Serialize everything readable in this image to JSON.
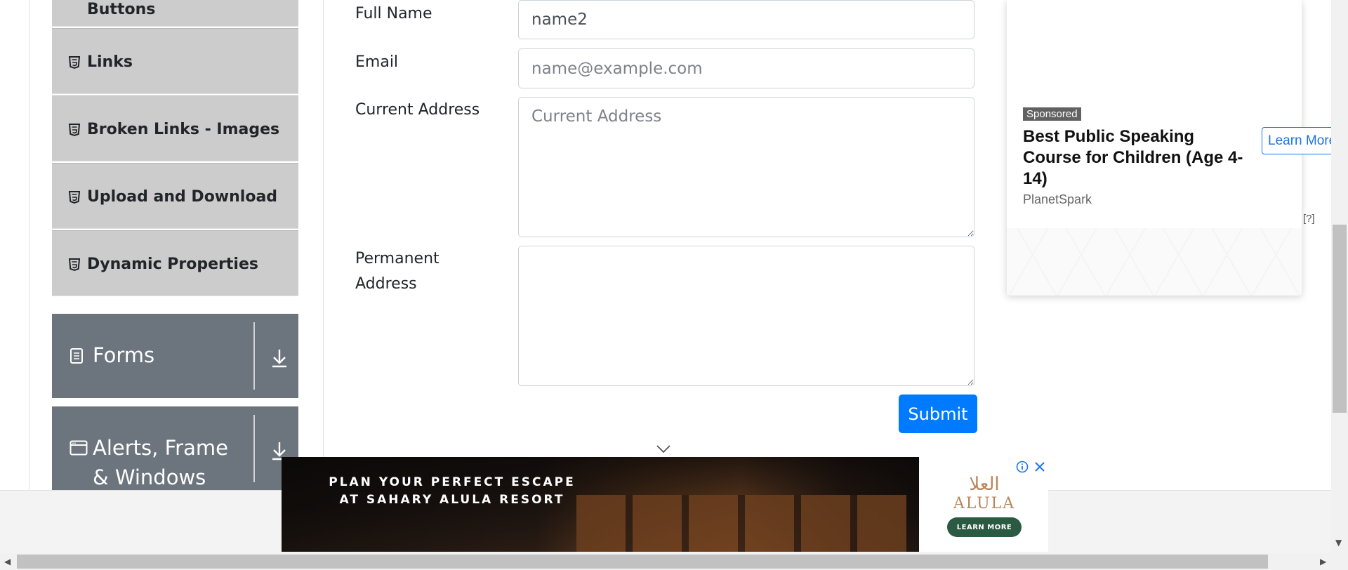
{
  "sidebar": {
    "top_partial_label": "Buttons",
    "items": [
      {
        "label": "Links",
        "icon": "html5-icon"
      },
      {
        "label": "Broken Links - Images",
        "icon": "html5-icon"
      },
      {
        "label": "Upload and Download",
        "icon": "html5-icon"
      },
      {
        "label": "Dynamic Properties",
        "icon": "html5-icon"
      }
    ],
    "groups": [
      {
        "label": "Forms",
        "icon": "document-icon",
        "arrow": "download-arrow-icon"
      },
      {
        "label": "Alerts, Frame & Windows",
        "icon": "window-icon",
        "arrow": "download-arrow-icon"
      }
    ]
  },
  "form": {
    "full_name": {
      "label": "Full Name",
      "value": "name2"
    },
    "email": {
      "label": "Email",
      "placeholder": "name@example.com",
      "value": ""
    },
    "current_address": {
      "label": "Current Address",
      "placeholder": "Current Address",
      "value": ""
    },
    "permanent_address": {
      "label": "Permanent Address",
      "value": ""
    },
    "submit_label": "Submit"
  },
  "ad_right": {
    "badge": "Sponsored",
    "title": "Best Public Speaking Course for Children (Age 4-14)",
    "brand": "PlanetSpark",
    "cta": "Learn More",
    "info": "[?]"
  },
  "ad_bottom": {
    "headline": "PLAN YOUR PERFECT ESCAPE AT SAHARY ALULA RESORT",
    "brand_ar": "العلا",
    "brand_en": "ALULA",
    "cta": "LEARN MORE"
  },
  "colors": {
    "primary": "#007bff",
    "sidebar_item_bg": "#cccccc",
    "group_bg": "#6c757d",
    "alula_green": "#2b5a43"
  }
}
